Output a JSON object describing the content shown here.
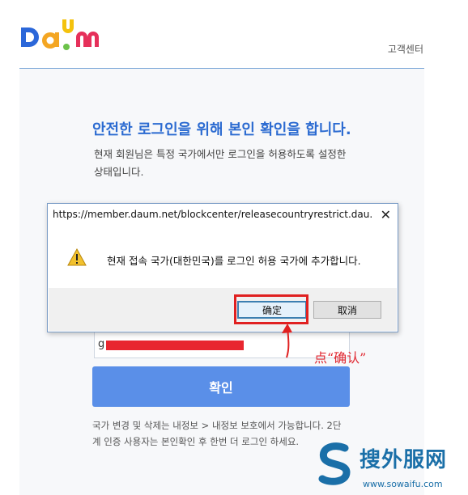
{
  "header": {
    "logo_text": "Daum",
    "support_link": "고객센터"
  },
  "main": {
    "title": "안전한 로그인을 위해 본인 확인을 합니다.",
    "description": "현재 회원님은 특정 국가에서만 로그인을 허용하도록 설정한 상태입니다.",
    "id_input_prefix": "g",
    "confirm_button": "확인",
    "note": "국가 변경 및 삭제는 내정보 > 내정보 보호에서 가능합니다. 2단계 인증 사용자는 본인확인 후 한번 더 로그인 하세요."
  },
  "dialog": {
    "title": "https://member.daum.net/blockcenter/releasecountryrestrict.dau...",
    "close_glyph": "✕",
    "message": "현재 접속 국가(대한민국)를 로그인 허용 국가에 추가합니다.",
    "ok_label": "确定",
    "cancel_label": "取消"
  },
  "annotation": {
    "text": "点“确认”",
    "color": "#e0262f"
  },
  "watermark": {
    "name": "搜外服网",
    "url": "www.sowaifu.com"
  },
  "colors": {
    "brand_blue": "#2c6bd1",
    "button_blue": "#5a8fe8",
    "highlight_red": "#e02020"
  }
}
